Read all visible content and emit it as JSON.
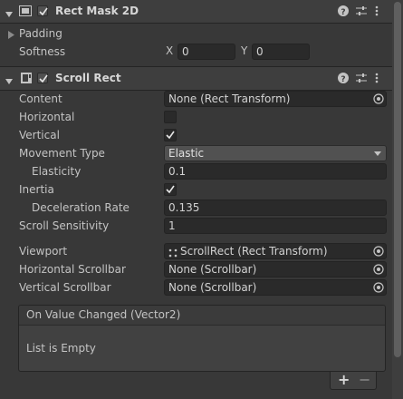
{
  "rect_mask": {
    "title": "Rect Mask 2D",
    "enabled": true,
    "padding_label": "Padding",
    "softness_label": "Softness",
    "softness_x_label": "X",
    "softness_x": "0",
    "softness_y_label": "Y",
    "softness_y": "0"
  },
  "scroll_rect": {
    "title": "Scroll Rect",
    "enabled": true,
    "content_label": "Content",
    "content_value": "None (Rect Transform)",
    "horizontal_label": "Horizontal",
    "horizontal_checked": false,
    "vertical_label": "Vertical",
    "vertical_checked": true,
    "movement_type_label": "Movement Type",
    "movement_type_value": "Elastic",
    "elasticity_label": "Elasticity",
    "elasticity_value": "0.1",
    "inertia_label": "Inertia",
    "inertia_checked": true,
    "deceleration_label": "Deceleration Rate",
    "deceleration_value": "0.135",
    "scroll_sensitivity_label": "Scroll Sensitivity",
    "scroll_sensitivity_value": "1",
    "viewport_label": "Viewport",
    "viewport_value": "ScrollRect (Rect Transform)",
    "hscrollbar_label": "Horizontal Scrollbar",
    "hscrollbar_value": "None (Scrollbar)",
    "vscrollbar_label": "Vertical Scrollbar",
    "vscrollbar_value": "None (Scrollbar)"
  },
  "event": {
    "title": "On Value Changed (Vector2)",
    "empty_text": "List is Empty",
    "add_label": "+",
    "remove_label": "−"
  },
  "icons": {
    "foldout": "triangle-right-icon",
    "help": "question-circle-icon",
    "preset": "sliders-icon",
    "menu": "kebab-icon",
    "object_picker": "target-circle-icon",
    "checkmark": "check-icon"
  },
  "colors": {
    "background": "#383838",
    "header": "#3e3e3e",
    "field": "#2a2a2a",
    "text": "#c4c4c4"
  }
}
